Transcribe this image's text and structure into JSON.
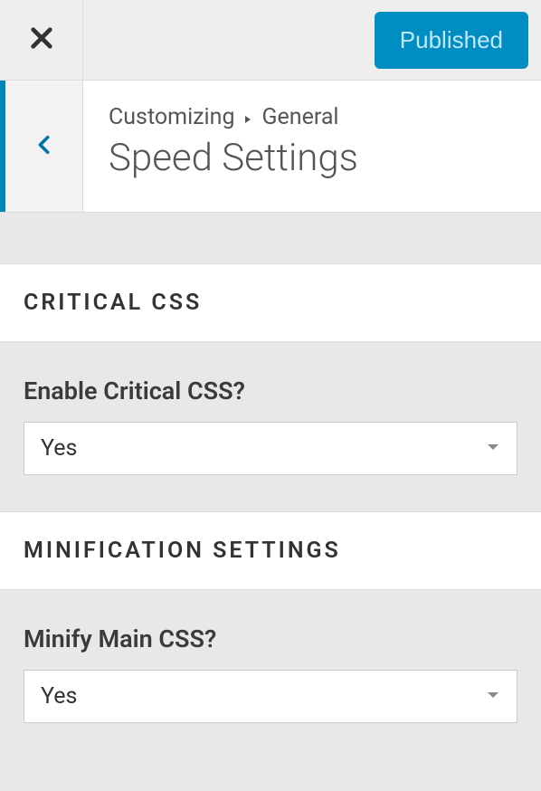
{
  "topbar": {
    "publish_label": "Published"
  },
  "breadcrumb": {
    "root": "Customizing",
    "section": "General"
  },
  "page_title": "Speed Settings",
  "sections": {
    "critical_css": {
      "header": "CRITICAL CSS",
      "control_label": "Enable Critical CSS?",
      "value": "Yes"
    },
    "minification": {
      "header": "MINIFICATION SETTINGS",
      "control_label": "Minify Main CSS?",
      "value": "Yes"
    }
  }
}
